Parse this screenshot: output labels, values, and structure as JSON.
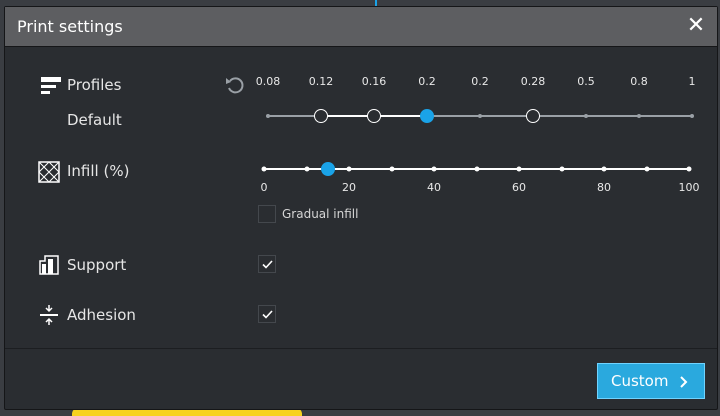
{
  "window": {
    "title": "Print settings"
  },
  "profiles": {
    "label": "Profiles",
    "default_label": "Default",
    "ticks": [
      "0.08",
      "0.12",
      "0.16",
      "0.2",
      "0.2",
      "0.28",
      "0.5",
      "0.8",
      "1"
    ]
  },
  "infill": {
    "label": "Infill (%)",
    "ticks": [
      "0",
      "20",
      "40",
      "60",
      "80",
      "100"
    ],
    "value": 15,
    "gradual_label": "Gradual infill",
    "gradual_checked": false
  },
  "support": {
    "label": "Support",
    "checked": true
  },
  "adhesion": {
    "label": "Adhesion",
    "checked": true
  },
  "footer": {
    "custom_label": "Custom"
  },
  "colors": {
    "accent": "#2aa9de",
    "panel": "#2a2d31",
    "titlebar": "#5d5e61"
  }
}
